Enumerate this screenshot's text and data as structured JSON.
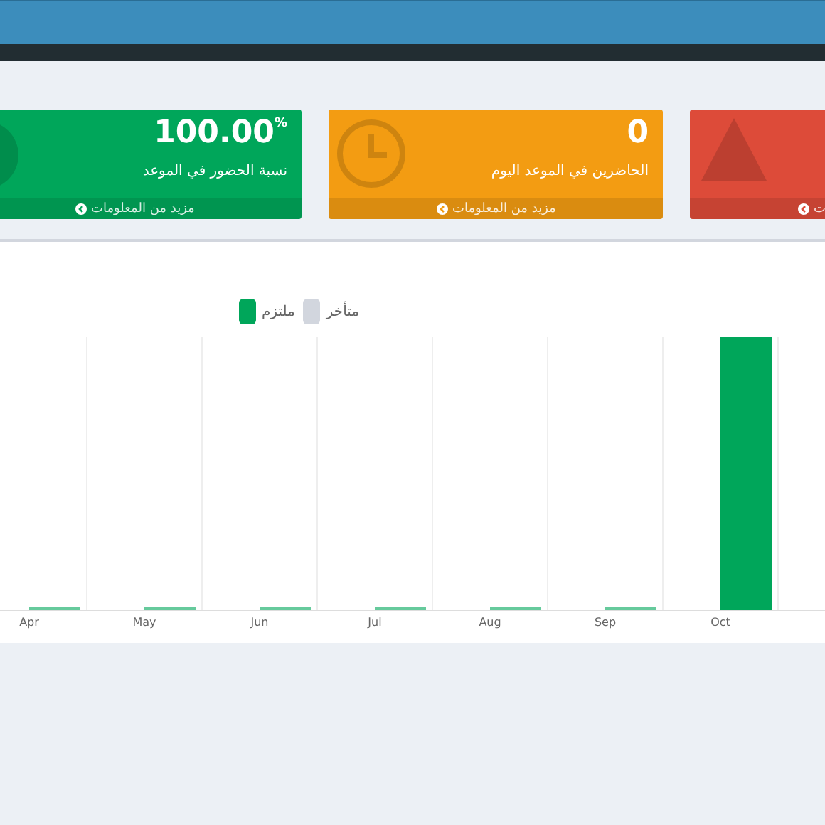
{
  "cards": [
    {
      "kind": "warning",
      "footer": "ت",
      "color": "#dd4b39"
    },
    {
      "kind": "clock",
      "value": "0",
      "label": "الحاضرين في الموعد اليوم",
      "footer": "مزيد من المعلومات",
      "color": "#f39c12"
    },
    {
      "kind": "pie",
      "value": "100.00",
      "unit": "%",
      "label": "نسبة الحضور في الموعد",
      "footer": "مزيد من المعلومات",
      "color": "#00a65a"
    }
  ],
  "chart": {
    "legend": [
      {
        "label": "متأخر",
        "color": "#d2d6de"
      },
      {
        "label": "ملتزم",
        "color": "#00a65a"
      }
    ],
    "axis_labels": [
      "Oct",
      "Sep",
      "Aug",
      "Jul",
      "Jun",
      "May",
      "Apr"
    ]
  }
}
